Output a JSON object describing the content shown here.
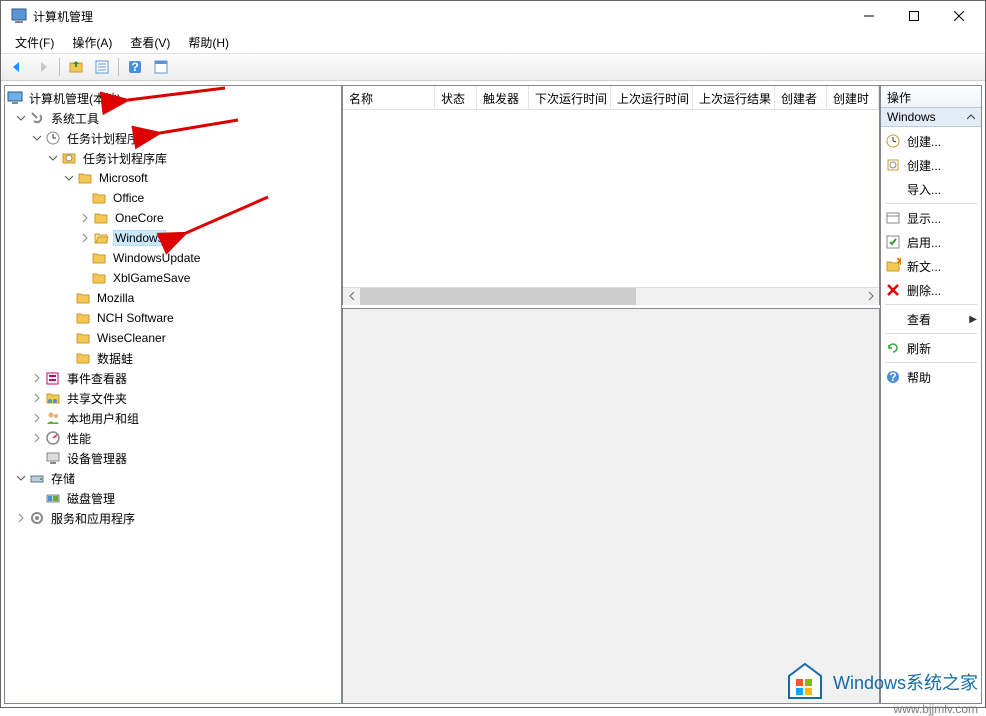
{
  "window": {
    "title": "计算机管理"
  },
  "menus": {
    "file": "文件(F)",
    "action": "操作(A)",
    "view": "查看(V)",
    "help": "帮助(H)"
  },
  "tree": {
    "root": "计算机管理(本地)",
    "sys_tools": "系统工具",
    "task_sched": "任务计划程序",
    "task_lib": "任务计划程序库",
    "microsoft": "Microsoft",
    "office": "Office",
    "onecore": "OneCore",
    "windows": "Windows",
    "windows_update": "WindowsUpdate",
    "xbl": "XblGameSave",
    "mozilla": "Mozilla",
    "nch": "NCH Software",
    "wise": "WiseCleaner",
    "datafrog": "数据蛙",
    "event_viewer": "事件查看器",
    "shared_folders": "共享文件夹",
    "local_users": "本地用户和组",
    "performance": "性能",
    "device_mgr": "设备管理器",
    "storage": "存储",
    "disk_mgmt": "磁盘管理",
    "services": "服务和应用程序"
  },
  "list_columns": {
    "name": "名称",
    "status": "状态",
    "trigger": "触发器",
    "next_run": "下次运行时间",
    "last_run": "上次运行时间",
    "last_result": "上次运行结果",
    "creator": "创建者",
    "create_time": "创建时"
  },
  "actions": {
    "header": "操作",
    "section": "Windows",
    "items": {
      "create1": "创建...",
      "create2": "创建...",
      "import": "导入...",
      "show": "显示...",
      "enable": "启用...",
      "newfolder": "新文...",
      "delete": "删除...",
      "view": "查看",
      "refresh": "刷新",
      "help": "帮助"
    }
  },
  "watermark": {
    "text": "Windows系统之家",
    "url": "www.bjjmlv.com"
  }
}
